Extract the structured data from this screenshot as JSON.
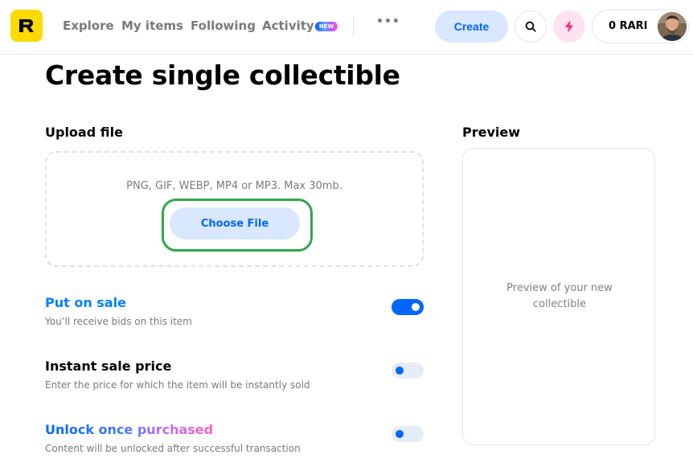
{
  "header": {
    "logo_icon": "rarible-logo-icon",
    "nav": [
      {
        "label": "Explore"
      },
      {
        "label": "My items"
      },
      {
        "label": "Following"
      },
      {
        "label": "Activity"
      }
    ],
    "activity_badge": "NEW",
    "more_icon": "more-dots-icon",
    "create_label": "Create",
    "search_icon": "search-icon",
    "bolt_icon": "lightning-bolt-icon",
    "wallet_balance": "0 RARI"
  },
  "main": {
    "title": "Create single collectible",
    "upload": {
      "label": "Upload file",
      "hint": "PNG, GIF, WEBP, MP4 or MP3. Max 30mb.",
      "button_label": "Choose File"
    },
    "preview": {
      "label": "Preview",
      "placeholder": "Preview of your new collectible"
    },
    "options": [
      {
        "title": "Put on sale",
        "description": "You’ll receive bids on this item",
        "enabled": true
      },
      {
        "title": "Instant sale price",
        "description": "Enter the price for which the item will be instantly sold",
        "enabled": false
      },
      {
        "title": "Unlock once purchased",
        "description": "Content will be unlocked after successful transaction",
        "enabled": false
      }
    ]
  },
  "colors": {
    "accent_blue": "#0066ff",
    "logo_yellow": "#feda03",
    "highlight_green": "#2ea84a"
  }
}
